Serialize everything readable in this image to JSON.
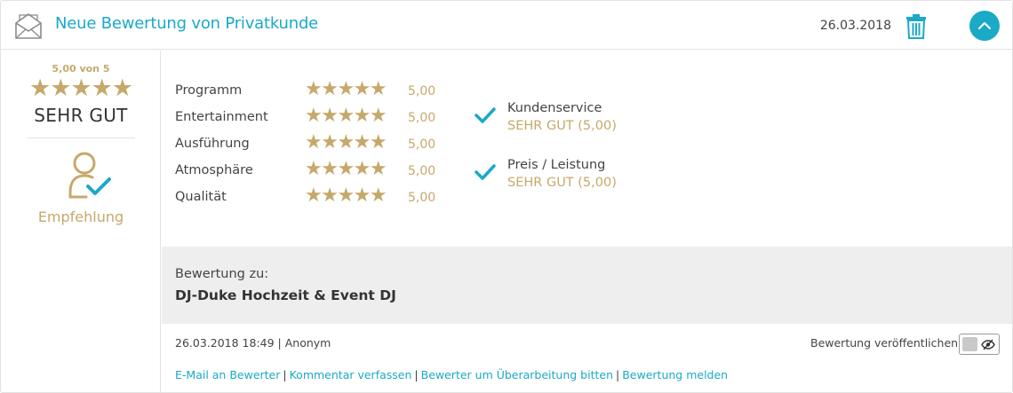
{
  "header": {
    "title": "Neue Bewertung von Privatkunde",
    "date": "26.03.2018",
    "icons": {
      "envelope": "open-envelope-icon",
      "trash": "trash-icon",
      "collapse": "chevron-up-icon"
    }
  },
  "summary": {
    "score_text": "5,00 von 5",
    "stars": "★★★★★",
    "grade": "SEHR GUT",
    "recommend_label": "Empfehlung",
    "recommend_icon": "user-check-icon"
  },
  "ratings": [
    {
      "name": "Programm",
      "stars": "★★★★★",
      "value": "5,00"
    },
    {
      "name": "Entertainment",
      "stars": "★★★★★",
      "value": "5,00"
    },
    {
      "name": "Ausführung",
      "stars": "★★★★★",
      "value": "5,00"
    },
    {
      "name": "Atmosphäre",
      "stars": "★★★★★",
      "value": "5,00"
    },
    {
      "name": "Qualität",
      "stars": "★★★★★",
      "value": "5,00"
    }
  ],
  "checks": [
    {
      "title": "Kundenservice",
      "sub": "SEHR GUT (5,00)"
    },
    {
      "title": "Preis / Leistung",
      "sub": "SEHR GUT (5,00)"
    }
  ],
  "review_for": {
    "label": "Bewertung zu:",
    "value": "DJ-Duke Hochzeit & Event DJ"
  },
  "footer": {
    "meta": "26.03.2018 18:49 | Anonym",
    "publish_label": "Bewertung veröffentlichen:",
    "publish_toggle_on": false,
    "links": [
      "E-Mail an Bewerter",
      "Kommentar verfassen",
      "Bewerter um Überarbeitung bitten",
      "Bewertung melden"
    ],
    "link_separator": "|"
  },
  "colors": {
    "accent": "#1ba9c7",
    "gold": "#c6a96a",
    "panel_grey": "#eeeeee",
    "border": "#e2e2e2"
  }
}
